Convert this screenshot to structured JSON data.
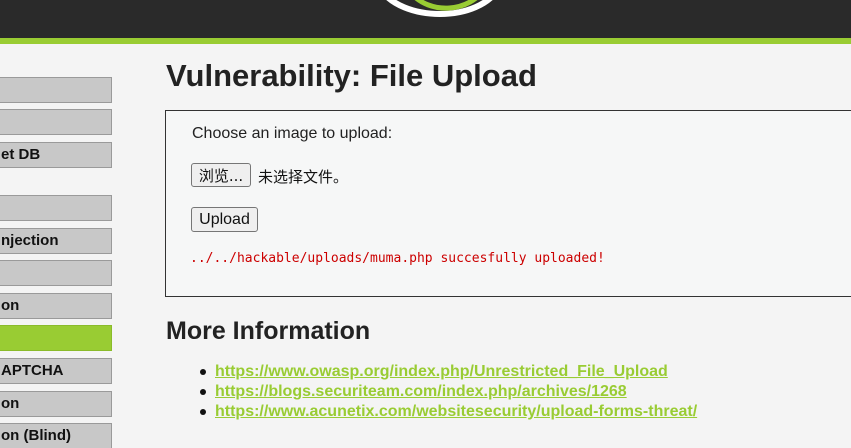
{
  "header": {
    "logo_icon": "dvwa-logo-swirl-icon"
  },
  "sidebar": {
    "items": [
      {
        "label": ""
      },
      {
        "label": ""
      },
      {
        "label": "et DB"
      },
      {
        "label": ""
      },
      {
        "label": "njection"
      },
      {
        "label": ""
      },
      {
        "label": "on"
      },
      {
        "label": "",
        "active": true
      },
      {
        "label": "APTCHA"
      },
      {
        "label": "on"
      },
      {
        "label": "on (Blind)"
      }
    ]
  },
  "main": {
    "title": "Vulnerability: File Upload",
    "upload": {
      "prompt": "Choose an image to upload:",
      "browse_label": "浏览...",
      "no_file_text": "未选择文件。",
      "upload_label": "Upload",
      "result_message": "../../hackable/uploads/muma.php succesfully uploaded!"
    },
    "more_info": {
      "title": "More Information",
      "links": [
        {
          "text": "https://www.owasp.org/index.php/Unrestricted_File_Upload"
        },
        {
          "text": "https://blogs.securiteam.com/index.php/archives/1268"
        },
        {
          "text": "https://www.acunetix.com/websitesecurity/upload-forms-threat/"
        }
      ]
    }
  },
  "colors": {
    "accent": "#99cc33",
    "header_bg": "#2a2a2a",
    "error_red": "#cc0000"
  }
}
